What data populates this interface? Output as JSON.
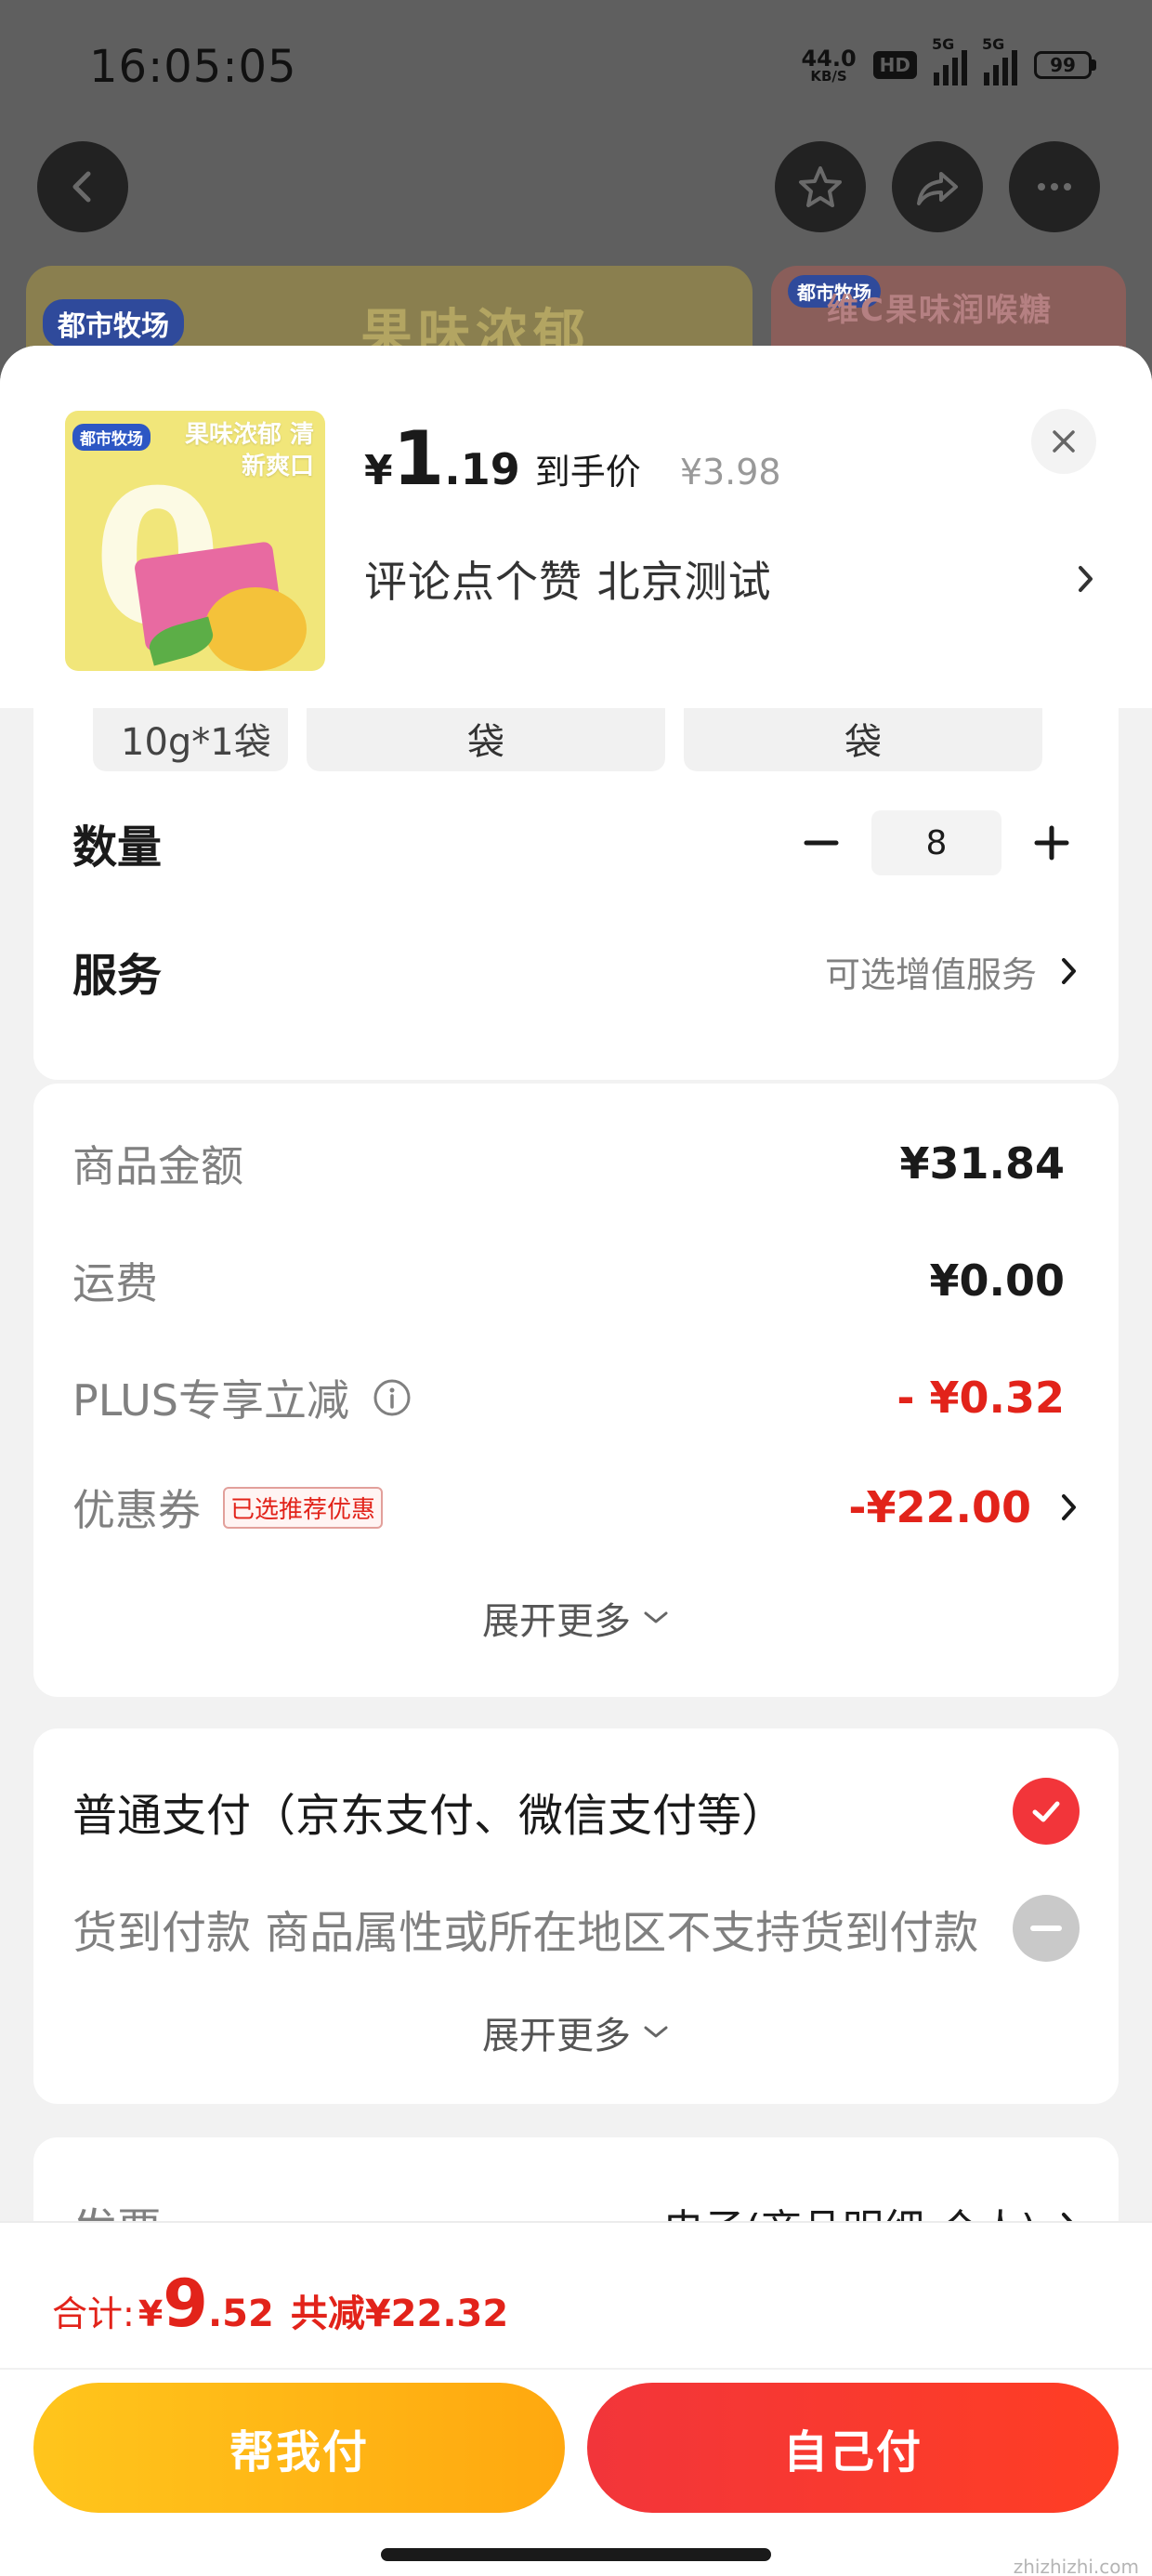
{
  "status_bar": {
    "time": "16:05:05",
    "net_speed": "44.0",
    "net_unit": "KB/S",
    "hd": "HD",
    "sim1": "5G",
    "sim2": "5G",
    "battery": "99"
  },
  "background": {
    "banner_brand": "都市牧场",
    "banner_text": "果味浓郁",
    "banner2_brand": "都市牧场",
    "banner2_text": "维C果味润喉糖"
  },
  "product": {
    "thumb_brand": "都市牧场",
    "thumb_slogan": "果味浓郁 清新爽口",
    "thumb_zero": "0",
    "price_symbol": "¥",
    "price_integer": "1",
    "price_decimal": ".19",
    "price_tag": "到手价",
    "original_price": "¥3.98",
    "address": "评论点个赞  北京测试"
  },
  "spec": {
    "chip1": "10g*1袋",
    "chip2": "袋",
    "chip3": "袋"
  },
  "quantity": {
    "label": "数量",
    "value": "8"
  },
  "service": {
    "label": "服务",
    "value": "可选增值服务"
  },
  "fees": {
    "items": [
      {
        "label": "商品金额",
        "value": "¥31.84"
      },
      {
        "label": "运费",
        "value": "¥0.00"
      },
      {
        "label": "PLUS专享立减",
        "value": "- ¥0.32"
      },
      {
        "label": "优惠券",
        "value": "-¥22.00"
      }
    ],
    "coupon_badge": "已选推荐优惠",
    "expand_label": "展开更多"
  },
  "payment": {
    "normal": "普通支付（京东支付、微信支付等）",
    "cod": "货到付款 商品属性或所在地区不支持货到付款",
    "expand_label": "展开更多"
  },
  "invoice": {
    "label": "发票",
    "value": "电子(商品明细-个人)"
  },
  "footer": {
    "total_label": "合计:",
    "total_symbol": "¥",
    "total_integer": "9",
    "total_decimal": ".52",
    "total_saved": "共减¥22.32",
    "btn_friend": "帮我付",
    "btn_self": "自己付",
    "watermark": "zhizhizhi.com"
  },
  "colors": {
    "accent_red": "#e2231a",
    "pay_yellow": "#ffb514",
    "pay_red": "#f2353a"
  }
}
